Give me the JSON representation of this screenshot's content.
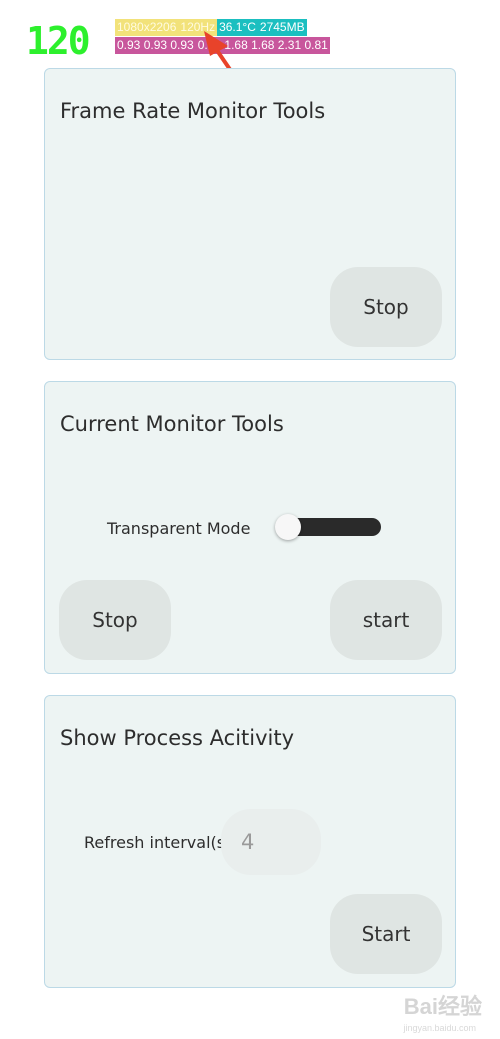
{
  "overlay": {
    "fps": "120",
    "row1": [
      "1080x2206",
      "120Hz",
      "36.1°C",
      "2745MB"
    ],
    "row2": [
      "0.93 0.93 0.93",
      "0.93 1.68 1.68 2.31 0.81"
    ]
  },
  "frame_rate_card": {
    "title": "Frame Rate Monitor Tools",
    "stop_label": "Stop"
  },
  "current_card": {
    "title": "Current Monitor Tools",
    "transparent_label": "Transparent Mode",
    "transparent_on": false,
    "stop_label": "Stop",
    "start_label": "start"
  },
  "process_card": {
    "title": "Show Process Acitivity",
    "interval_label": "Refresh interval(s):",
    "interval_value": "4",
    "start_label": "Start"
  },
  "watermark": {
    "text": "Bai经验",
    "url": "jingyan.baidu.com"
  },
  "colors": {
    "fps": "#2df02d",
    "hud_yellow": "#f2e27a",
    "hud_teal": "#1bbfc0",
    "hud_pink": "#c8569c",
    "card_bg": "#edf4f3",
    "card_border": "#bcd9e6",
    "arrow": "#e8432a"
  }
}
